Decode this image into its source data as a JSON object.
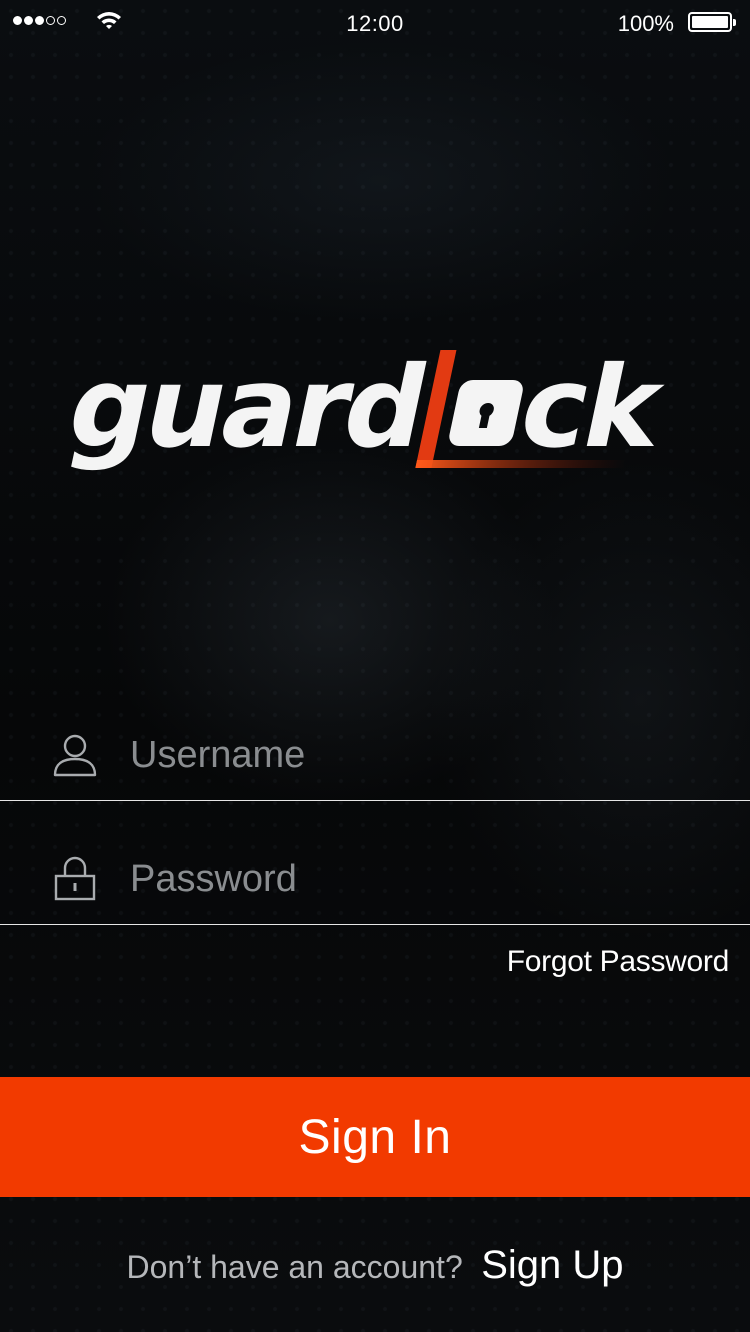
{
  "status_bar": {
    "time": "12:00",
    "battery_percent": "100%",
    "signal_bars_filled": 3,
    "signal_bars_total": 5,
    "battery_level": 1.0
  },
  "logo": {
    "text_white": "guard",
    "text_accent_letter": "L",
    "text_white_end": "ck",
    "accent_color": "#e23a12"
  },
  "login_form": {
    "username_placeholder": "Username",
    "username_value": "",
    "password_placeholder": "Password",
    "password_value": "",
    "forgot_password_label": "Forgot Password",
    "sign_in_label": "Sign In"
  },
  "signup": {
    "prompt": "Don’t have an account?",
    "link_label": "Sign Up"
  },
  "colors": {
    "primary_button": "#f23a00",
    "background": "#050607",
    "placeholder": "#8a8d90"
  },
  "icons": {
    "username": "user-icon",
    "password": "lock-icon",
    "wifi": "wifi-icon",
    "battery": "battery-icon"
  }
}
